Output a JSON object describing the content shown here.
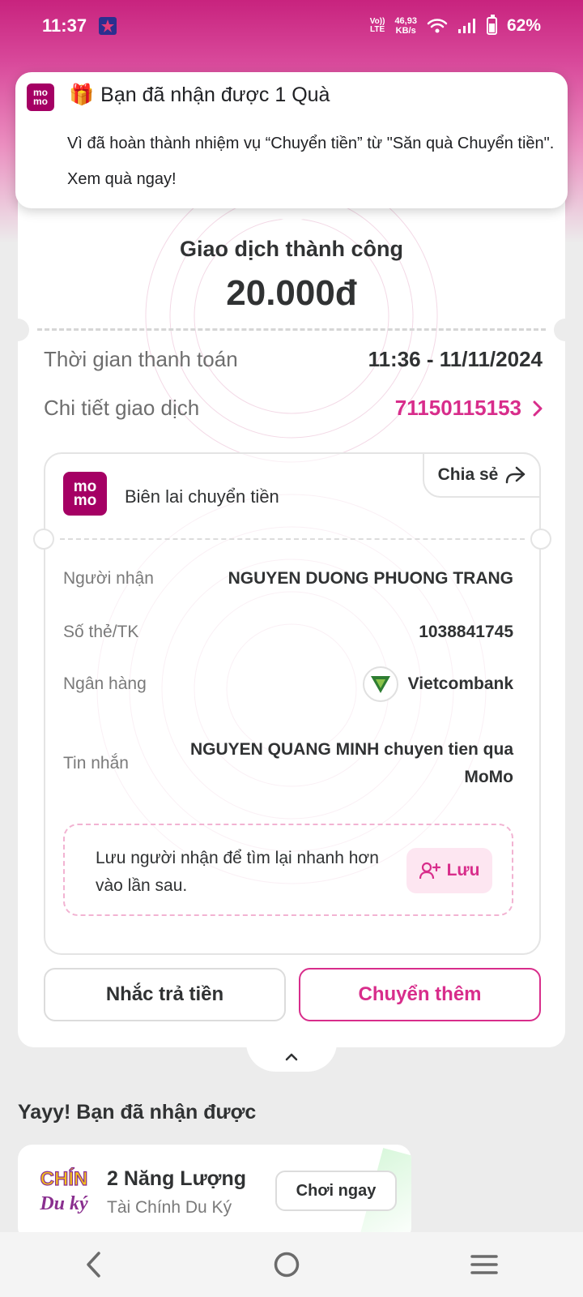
{
  "status_bar": {
    "time": "11:37",
    "network_label_top": "Vo))",
    "network_label_bottom": "LTE",
    "speed_value": "46,93",
    "speed_unit": "KB/s",
    "battery": "62%"
  },
  "notification": {
    "app_logo_top": "mo",
    "app_logo_bottom": "mo",
    "gift_icon": "🎁",
    "title": "Bạn đã nhận được 1 Quà",
    "body": "Vì đã hoàn thành nhiệm vụ “Chuyển tiền” từ \"Săn quà Chuyển tiền\". Xem quà ngay!"
  },
  "transaction": {
    "status": "Giao dịch thành công",
    "amount": "20.000đ",
    "payment_time_label": "Thời gian thanh toán",
    "payment_time_value": "11:36 - 11/11/2024",
    "detail_label": "Chi tiết giao dịch",
    "detail_value": "71150115153"
  },
  "receipt": {
    "logo_top": "mo",
    "logo_bottom": "mo",
    "title": "Biên lai chuyển tiền",
    "share_label": "Chia sẻ",
    "rows": [
      {
        "label": "Người nhận",
        "value": "NGUYEN DUONG PHUONG TRANG"
      },
      {
        "label": "Số thẻ/TK",
        "value": "1038841745"
      },
      {
        "label": "Ngân hàng",
        "value": "Vietcombank"
      },
      {
        "label": "Tin nhắn",
        "value": "NGUYEN QUANG MINH chuyen tien qua MoMo"
      }
    ],
    "save_prompt": "Lưu người nhận để tìm lại nhanh hơn vào lần sau.",
    "save_label": "Lưu"
  },
  "actions": {
    "remind_label": "Nhắc trả tiền",
    "transfer_more_label": "Chuyển thêm"
  },
  "rewards": {
    "heading": "Yayy! Bạn đã nhận được",
    "items": [
      {
        "title": "2 Năng Lượng",
        "subtitle": "Tài Chính Du Ký",
        "button": "Chơi ngay",
        "logo_line1": "CHÍN",
        "logo_line2": "Du ký"
      }
    ]
  },
  "colors": {
    "brand": "#a50064",
    "accent": "#d82d8b",
    "success": "#5cb82e"
  }
}
